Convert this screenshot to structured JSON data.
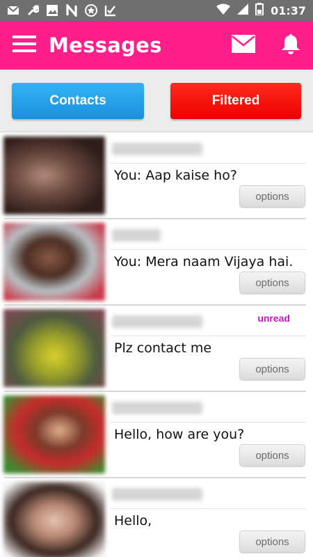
{
  "status_bar": {
    "time": "01:37",
    "icons_left": [
      "mail-icon",
      "wrench-icon",
      "image-icon",
      "n-icon",
      "star-icon",
      "checkmark-icon"
    ],
    "icons_right": [
      "wifi-icon",
      "signal-icon",
      "battery-icon"
    ]
  },
  "app_bar": {
    "title": "Messages",
    "icons": [
      "hamburger-menu-icon",
      "mail-icon",
      "bell-icon"
    ]
  },
  "tabs": {
    "contacts": "Contacts",
    "filtered": "Filtered"
  },
  "conversations": [
    {
      "message": "You: Aap kaise ho?",
      "options": "options",
      "unread": ""
    },
    {
      "message": "You: Mera naam Vijaya hai.",
      "options": "options",
      "unread": ""
    },
    {
      "message": "Plz contact me",
      "options": "options",
      "unread": "unread"
    },
    {
      "message": "Hello, how are you?",
      "options": "options",
      "unread": ""
    },
    {
      "message": "Hello,",
      "options": "options",
      "unread": ""
    }
  ],
  "colors": {
    "app_bar": "#ff1f8a",
    "contacts_tab": "#1a91de",
    "filtered_tab": "#ee0000",
    "unread": "#c218c7"
  }
}
